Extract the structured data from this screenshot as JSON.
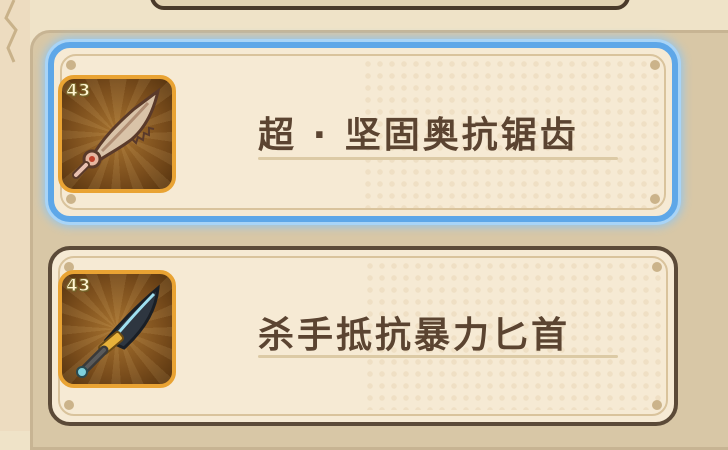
{
  "items": [
    {
      "name": "超 · 坚固奥抗锯齿",
      "level": "43",
      "icon": "serrated-blade-icon",
      "selected": true
    },
    {
      "name": "杀手抵抗暴力匕首",
      "level": "43",
      "icon": "dagger-icon",
      "selected": false
    }
  ],
  "colors": {
    "selected_border": "#5ea7e8",
    "card_border": "#5b4a38",
    "card_bg": "#f6ead4",
    "text": "#5b4431",
    "icon_border": "#e9a333"
  }
}
